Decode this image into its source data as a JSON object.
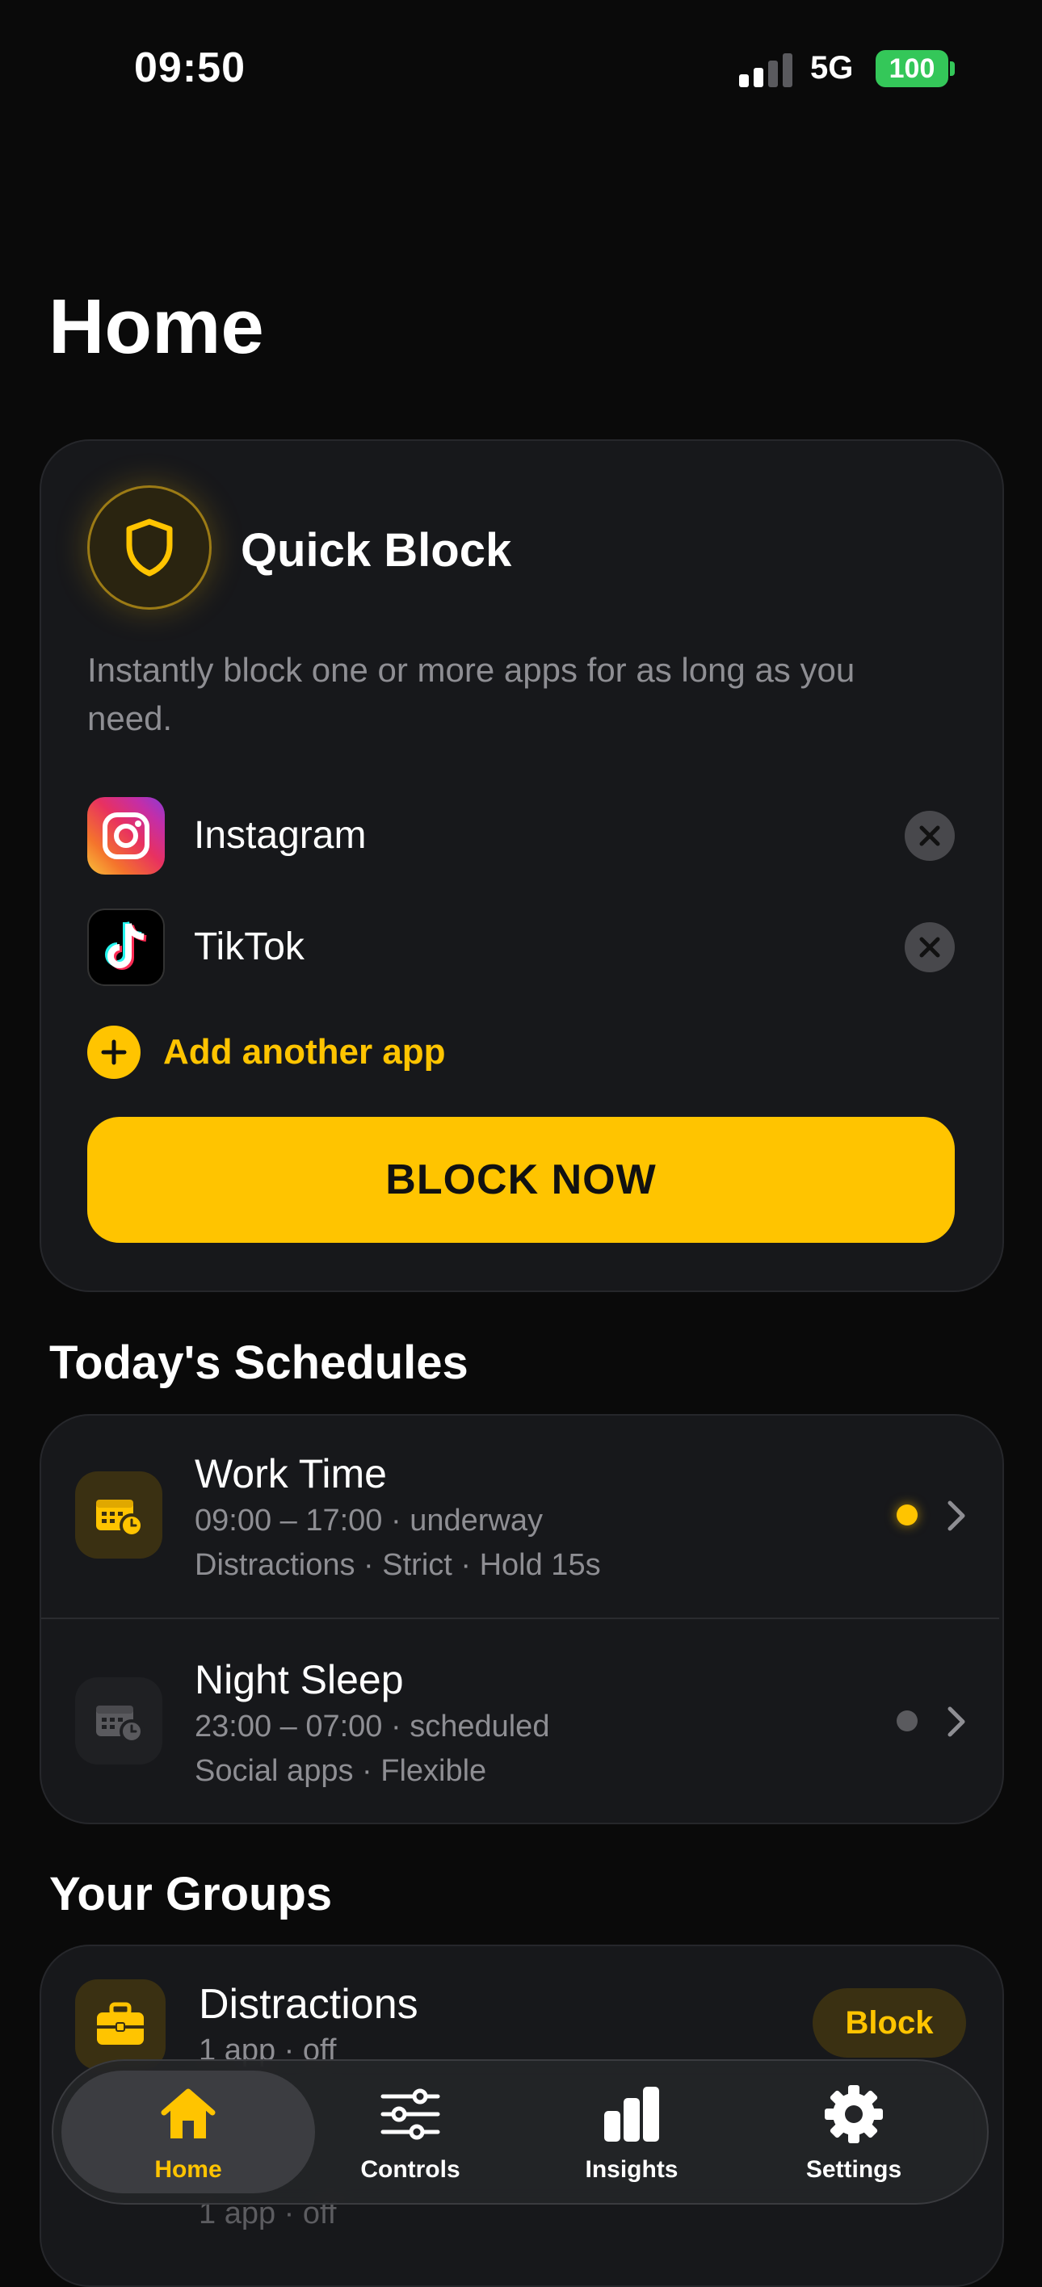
{
  "status_bar": {
    "time": "09:50",
    "network": "5G",
    "battery": "100"
  },
  "page": {
    "title": "Home"
  },
  "quick_block": {
    "title": "Quick Block",
    "description": "Instantly block one or more apps for as long as you need.",
    "apps": [
      {
        "name": "Instagram",
        "icon": "instagram-icon"
      },
      {
        "name": "TikTok",
        "icon": "tiktok-icon"
      }
    ],
    "add_label": "Add another app",
    "block_button": "BLOCK NOW"
  },
  "schedules": {
    "title": "Today's Schedules",
    "items": [
      {
        "name": "Work Time",
        "time": "09:00 – 17:00 · underway",
        "details": "Distractions · Strict · Hold 15s",
        "status_color": "#ffc400"
      },
      {
        "name": "Night Sleep",
        "time": "23:00 – 07:00 · scheduled",
        "details": "Social apps · Flexible",
        "status_color": "#5a5a5e"
      }
    ]
  },
  "groups": {
    "title": "Your Groups",
    "items": [
      {
        "name": "Distractions",
        "summary": "1 app · off",
        "action": "Block"
      },
      {
        "name": "",
        "summary": "1 app · off"
      }
    ]
  },
  "tab_bar": {
    "tabs": [
      {
        "label": "Home",
        "icon": "house-icon",
        "active": true
      },
      {
        "label": "Controls",
        "icon": "sliders-icon"
      },
      {
        "label": "Insights",
        "icon": "bar-chart-icon"
      },
      {
        "label": "Settings",
        "icon": "gear-icon"
      }
    ]
  },
  "colors": {
    "accent": "#ffc400",
    "background": "#0a0a0a",
    "card": "#17181b",
    "battery": "#34c759"
  }
}
